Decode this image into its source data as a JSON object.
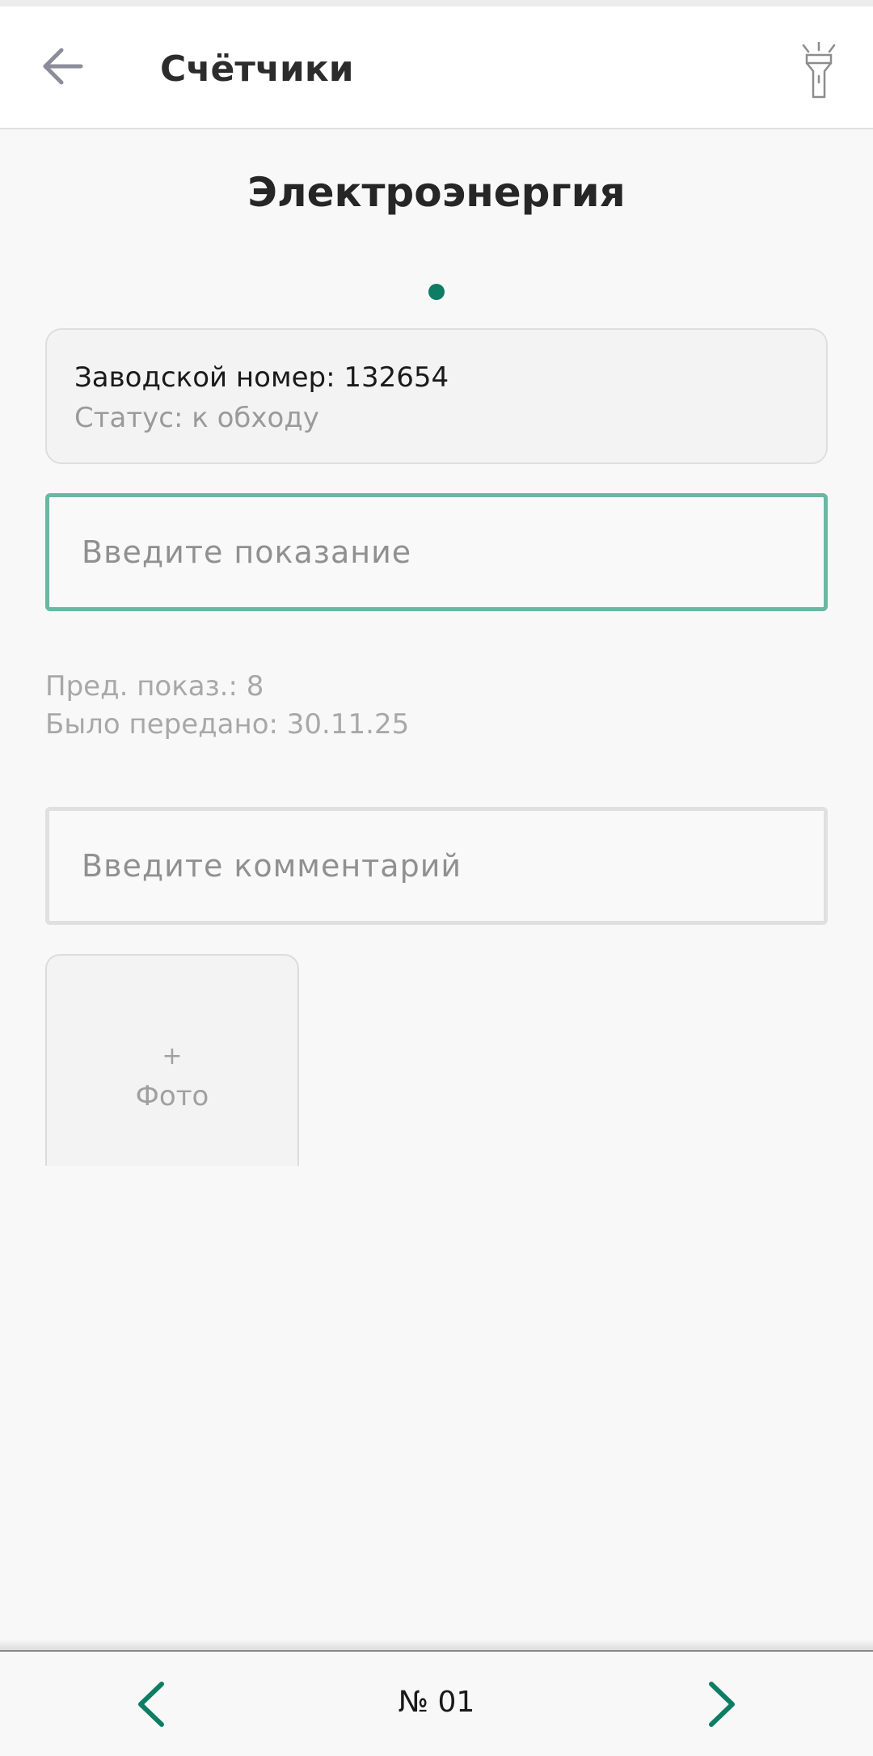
{
  "header": {
    "title": "Счётчики",
    "back_icon": "arrow-left-icon",
    "flashlight_icon": "flashlight-icon"
  },
  "section": {
    "title": "Электроэнергия"
  },
  "meter": {
    "serial": "Заводской номер: 132654",
    "status": "Статус: к обходу"
  },
  "reading": {
    "placeholder": "Введите показание",
    "value": ""
  },
  "history": {
    "previous": "Пред. показ.: 8",
    "sent": "Было передано: 30.11.25"
  },
  "comment": {
    "placeholder": "Введите комментарий",
    "value": ""
  },
  "photo": {
    "plus": "+",
    "label": "Фото"
  },
  "footer": {
    "number": "№ 01",
    "prev_icon": "chevron-left-icon",
    "next_icon": "chevron-right-icon"
  },
  "colors": {
    "accent": "#0d7d63",
    "active_border": "#6cb6a3",
    "muted_text": "#a8a8a8"
  }
}
